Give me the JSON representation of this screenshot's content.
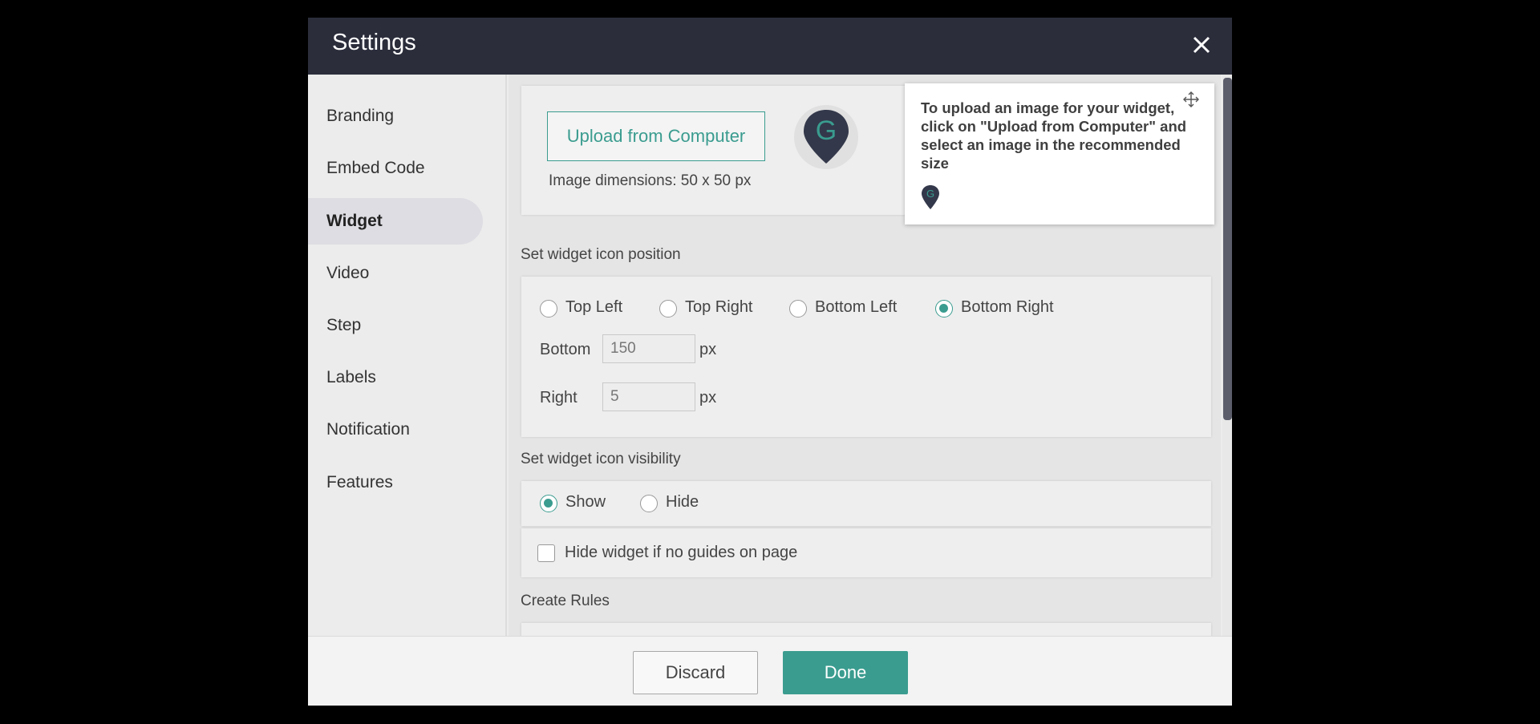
{
  "header": {
    "title": "Settings",
    "close_icon": "close-icon"
  },
  "sidebar": {
    "items": [
      {
        "label": "Branding"
      },
      {
        "label": "Embed Code"
      },
      {
        "label": "Widget",
        "active": true
      },
      {
        "label": "Video"
      },
      {
        "label": "Step"
      },
      {
        "label": "Labels"
      },
      {
        "label": "Notification"
      },
      {
        "label": "Features"
      }
    ]
  },
  "upload": {
    "button_label": "Upload from Computer",
    "dimensions_text": "Image dimensions: 50 x 50 px",
    "icon": "map-pin-g-icon"
  },
  "position": {
    "section_label": "Set widget icon position",
    "options": [
      {
        "label": "Top Left",
        "checked": false
      },
      {
        "label": "Top Right",
        "checked": false
      },
      {
        "label": "Bottom Left",
        "checked": false
      },
      {
        "label": "Bottom Right",
        "checked": true
      }
    ],
    "bottom_label": "Bottom",
    "bottom_value": "150",
    "right_label": "Right",
    "right_value": "5",
    "unit": "px"
  },
  "visibility": {
    "section_label": "Set widget icon visibility",
    "show_label": "Show",
    "hide_label": "Hide",
    "selected": "Show",
    "hide_if_none_label": "Hide widget if no guides on page",
    "hide_if_none_checked": false
  },
  "rules": {
    "section_label": "Create Rules"
  },
  "tooltip": {
    "text": "To upload an image for your widget, click on \"Upload from Computer\" and select an image in the recommended size",
    "icon": "map-pin-g-icon"
  },
  "footer": {
    "discard_label": "Discard",
    "done_label": "Done"
  },
  "colors": {
    "accent": "#3a9c8f",
    "header_bg": "#2b2d3b",
    "pin": "#33384a"
  }
}
